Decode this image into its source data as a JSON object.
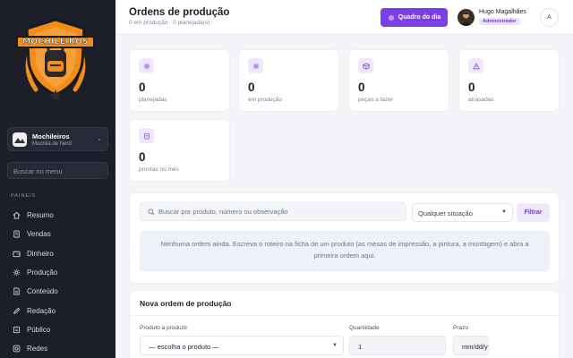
{
  "brand": {
    "logo_text": "MOCHILEIROS"
  },
  "sidebar": {
    "store": {
      "name": "Mochileiros",
      "subtitle": "Mochila de Nerd"
    },
    "search_placeholder": "Buscar no menu",
    "section_label": "PAINÉIS",
    "items": [
      {
        "label": "Resumo",
        "icon": "home-icon"
      },
      {
        "label": "Vendas",
        "icon": "receipt-icon"
      },
      {
        "label": "Dinheiro",
        "icon": "wallet-icon"
      },
      {
        "label": "Produção",
        "icon": "gear-icon"
      },
      {
        "label": "Conteúdo",
        "icon": "document-icon"
      },
      {
        "label": "Redação",
        "icon": "pen-icon"
      },
      {
        "label": "Público",
        "icon": "users-icon"
      },
      {
        "label": "Redes",
        "icon": "instagram-icon"
      }
    ]
  },
  "header": {
    "title": "Ordens de produção",
    "subtitle": "0 em produção · 0 planejada(s)",
    "day_button": "Quadro do dia",
    "user": {
      "name": "Hugo Magalhães",
      "role": "Administrador",
      "initial": "A"
    }
  },
  "stats": [
    {
      "value": "0",
      "label": "planejadas",
      "icon": "gear-icon"
    },
    {
      "value": "0",
      "label": "em produção",
      "icon": "gear-icon"
    },
    {
      "value": "0",
      "label": "peças a fazer",
      "icon": "box-icon"
    },
    {
      "value": "0",
      "label": "atrasadas",
      "icon": "warning-icon"
    },
    {
      "value": "0",
      "label": "prontas no mês",
      "icon": "clipboard-icon"
    }
  ],
  "filter": {
    "search_placeholder": "Buscar por produto, número ou observação",
    "status_value": "Qualquer situação",
    "button": "Filtrar",
    "empty_message": "Nenhuma ordem ainda. Escreva o roteiro na ficha de um produto (as mesas de impressão, a pintura, a montagem) e abra a primeira ordem aqui."
  },
  "new_order": {
    "title": "Nova ordem de produção",
    "product_label": "Produto a produzir",
    "product_value": "— escolha o produto —",
    "quantity_label": "Quantidade",
    "quantity_value": "1",
    "deadline_label": "Prazo",
    "deadline_value": "mm/dd/yyyy"
  },
  "colors": {
    "accent": "#7b3fe4",
    "sidebar_bg": "#1c1f2a",
    "logo_orange": "#f28c1b"
  }
}
